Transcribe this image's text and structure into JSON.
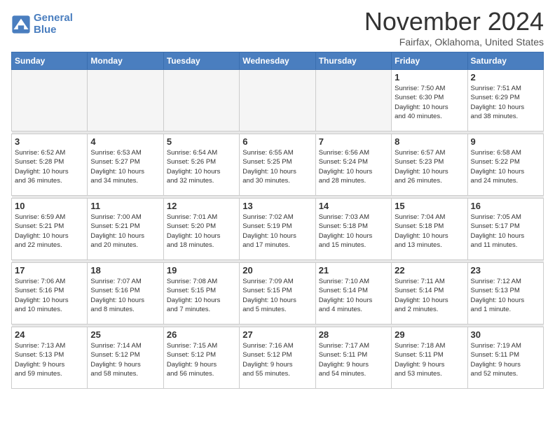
{
  "header": {
    "logo_line1": "General",
    "logo_line2": "Blue",
    "month": "November 2024",
    "location": "Fairfax, Oklahoma, United States"
  },
  "weekdays": [
    "Sunday",
    "Monday",
    "Tuesday",
    "Wednesday",
    "Thursday",
    "Friday",
    "Saturday"
  ],
  "weeks": [
    [
      {
        "day": "",
        "info": ""
      },
      {
        "day": "",
        "info": ""
      },
      {
        "day": "",
        "info": ""
      },
      {
        "day": "",
        "info": ""
      },
      {
        "day": "",
        "info": ""
      },
      {
        "day": "1",
        "info": "Sunrise: 7:50 AM\nSunset: 6:30 PM\nDaylight: 10 hours\nand 40 minutes."
      },
      {
        "day": "2",
        "info": "Sunrise: 7:51 AM\nSunset: 6:29 PM\nDaylight: 10 hours\nand 38 minutes."
      }
    ],
    [
      {
        "day": "3",
        "info": "Sunrise: 6:52 AM\nSunset: 5:28 PM\nDaylight: 10 hours\nand 36 minutes."
      },
      {
        "day": "4",
        "info": "Sunrise: 6:53 AM\nSunset: 5:27 PM\nDaylight: 10 hours\nand 34 minutes."
      },
      {
        "day": "5",
        "info": "Sunrise: 6:54 AM\nSunset: 5:26 PM\nDaylight: 10 hours\nand 32 minutes."
      },
      {
        "day": "6",
        "info": "Sunrise: 6:55 AM\nSunset: 5:25 PM\nDaylight: 10 hours\nand 30 minutes."
      },
      {
        "day": "7",
        "info": "Sunrise: 6:56 AM\nSunset: 5:24 PM\nDaylight: 10 hours\nand 28 minutes."
      },
      {
        "day": "8",
        "info": "Sunrise: 6:57 AM\nSunset: 5:23 PM\nDaylight: 10 hours\nand 26 minutes."
      },
      {
        "day": "9",
        "info": "Sunrise: 6:58 AM\nSunset: 5:22 PM\nDaylight: 10 hours\nand 24 minutes."
      }
    ],
    [
      {
        "day": "10",
        "info": "Sunrise: 6:59 AM\nSunset: 5:21 PM\nDaylight: 10 hours\nand 22 minutes."
      },
      {
        "day": "11",
        "info": "Sunrise: 7:00 AM\nSunset: 5:21 PM\nDaylight: 10 hours\nand 20 minutes."
      },
      {
        "day": "12",
        "info": "Sunrise: 7:01 AM\nSunset: 5:20 PM\nDaylight: 10 hours\nand 18 minutes."
      },
      {
        "day": "13",
        "info": "Sunrise: 7:02 AM\nSunset: 5:19 PM\nDaylight: 10 hours\nand 17 minutes."
      },
      {
        "day": "14",
        "info": "Sunrise: 7:03 AM\nSunset: 5:18 PM\nDaylight: 10 hours\nand 15 minutes."
      },
      {
        "day": "15",
        "info": "Sunrise: 7:04 AM\nSunset: 5:18 PM\nDaylight: 10 hours\nand 13 minutes."
      },
      {
        "day": "16",
        "info": "Sunrise: 7:05 AM\nSunset: 5:17 PM\nDaylight: 10 hours\nand 11 minutes."
      }
    ],
    [
      {
        "day": "17",
        "info": "Sunrise: 7:06 AM\nSunset: 5:16 PM\nDaylight: 10 hours\nand 10 minutes."
      },
      {
        "day": "18",
        "info": "Sunrise: 7:07 AM\nSunset: 5:16 PM\nDaylight: 10 hours\nand 8 minutes."
      },
      {
        "day": "19",
        "info": "Sunrise: 7:08 AM\nSunset: 5:15 PM\nDaylight: 10 hours\nand 7 minutes."
      },
      {
        "day": "20",
        "info": "Sunrise: 7:09 AM\nSunset: 5:15 PM\nDaylight: 10 hours\nand 5 minutes."
      },
      {
        "day": "21",
        "info": "Sunrise: 7:10 AM\nSunset: 5:14 PM\nDaylight: 10 hours\nand 4 minutes."
      },
      {
        "day": "22",
        "info": "Sunrise: 7:11 AM\nSunset: 5:14 PM\nDaylight: 10 hours\nand 2 minutes."
      },
      {
        "day": "23",
        "info": "Sunrise: 7:12 AM\nSunset: 5:13 PM\nDaylight: 10 hours\nand 1 minute."
      }
    ],
    [
      {
        "day": "24",
        "info": "Sunrise: 7:13 AM\nSunset: 5:13 PM\nDaylight: 9 hours\nand 59 minutes."
      },
      {
        "day": "25",
        "info": "Sunrise: 7:14 AM\nSunset: 5:12 PM\nDaylight: 9 hours\nand 58 minutes."
      },
      {
        "day": "26",
        "info": "Sunrise: 7:15 AM\nSunset: 5:12 PM\nDaylight: 9 hours\nand 56 minutes."
      },
      {
        "day": "27",
        "info": "Sunrise: 7:16 AM\nSunset: 5:12 PM\nDaylight: 9 hours\nand 55 minutes."
      },
      {
        "day": "28",
        "info": "Sunrise: 7:17 AM\nSunset: 5:11 PM\nDaylight: 9 hours\nand 54 minutes."
      },
      {
        "day": "29",
        "info": "Sunrise: 7:18 AM\nSunset: 5:11 PM\nDaylight: 9 hours\nand 53 minutes."
      },
      {
        "day": "30",
        "info": "Sunrise: 7:19 AM\nSunset: 5:11 PM\nDaylight: 9 hours\nand 52 minutes."
      }
    ]
  ]
}
